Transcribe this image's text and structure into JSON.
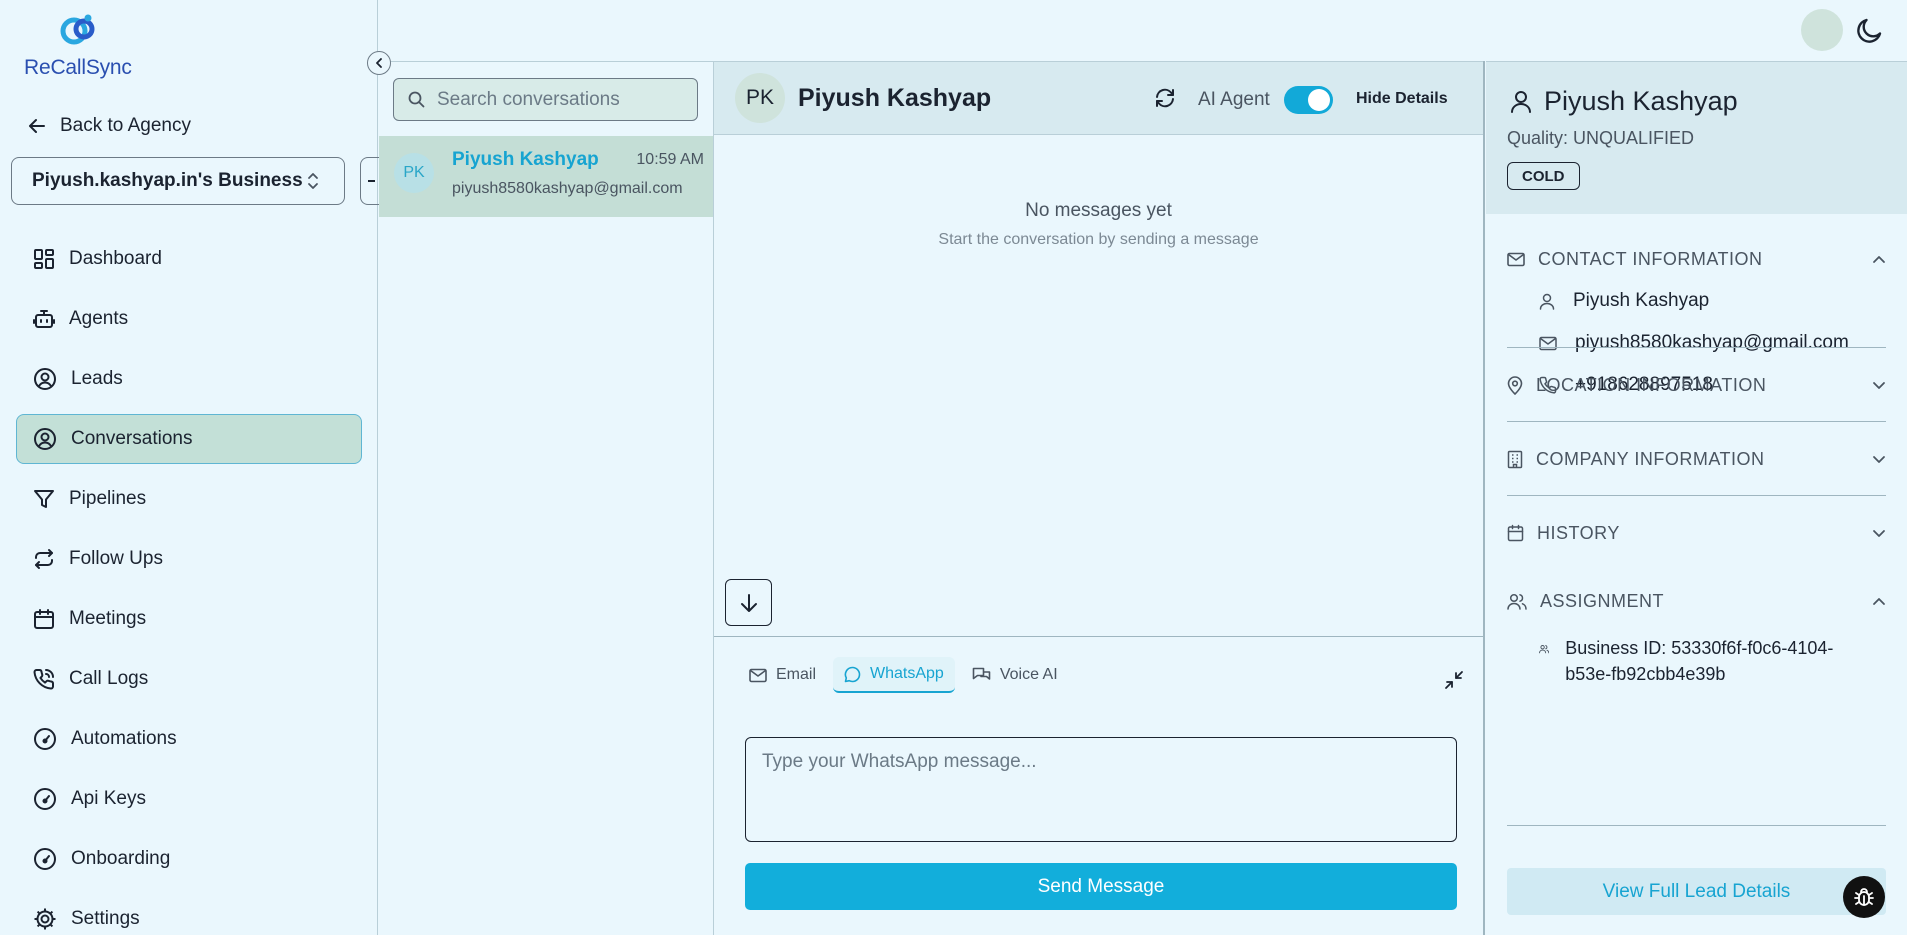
{
  "brand": {
    "name": "ReCallSync",
    "accent": "#17a4d1"
  },
  "sidebar": {
    "back_label": "Back to Agency",
    "business": "Piyush.kashyap.in's Business",
    "items": [
      {
        "label": "Dashboard",
        "icon": "dashboard-icon",
        "active": false
      },
      {
        "label": "Agents",
        "icon": "bot-icon",
        "active": false
      },
      {
        "label": "Leads",
        "icon": "user-circle-icon",
        "active": false
      },
      {
        "label": "Conversations",
        "icon": "user-circle-icon",
        "active": true
      },
      {
        "label": "Pipelines",
        "icon": "filter-icon",
        "active": false
      },
      {
        "label": "Follow Ups",
        "icon": "repeat-icon",
        "active": false
      },
      {
        "label": "Meetings",
        "icon": "calendar-icon",
        "active": false
      },
      {
        "label": "Call Logs",
        "icon": "phone-call-icon",
        "active": false
      },
      {
        "label": "Automations",
        "icon": "gauge-icon",
        "active": false
      },
      {
        "label": "Api Keys",
        "icon": "gauge-icon",
        "active": false
      },
      {
        "label": "Onboarding",
        "icon": "gauge-icon",
        "active": false
      },
      {
        "label": "Settings",
        "icon": "gear-icon",
        "active": false
      }
    ]
  },
  "conversations": {
    "search_placeholder": "Search conversations",
    "items": [
      {
        "initials": "PK",
        "name": "Piyush Kashyap",
        "time": "10:59 AM",
        "email": "piyush8580kashyap@gmail.com"
      }
    ]
  },
  "chat": {
    "initials": "PK",
    "name": "Piyush Kashyap",
    "ai_agent_label": "AI Agent",
    "ai_agent_on": true,
    "hide_details_label": "Hide Details",
    "empty_title": "No messages yet",
    "empty_subtitle": "Start the conversation by sending a message",
    "channels": [
      {
        "label": "Email",
        "icon": "mail-icon",
        "active": false
      },
      {
        "label": "WhatsApp",
        "icon": "message-circle-icon",
        "active": true
      },
      {
        "label": "Voice AI",
        "icon": "messages-icon",
        "active": false
      }
    ],
    "message_placeholder": "Type your WhatsApp message...",
    "send_label": "Send Message"
  },
  "details": {
    "name": "Piyush Kashyap",
    "quality": "Quality: UNQUALIFIED",
    "badge": "COLD",
    "contact": {
      "title": "CONTACT INFORMATION",
      "name": "Piyush Kashyap",
      "email": "piyush8580kashyap@gmail.com",
      "phone": "+918628897518"
    },
    "location_title": "LOCATION INFORMATION",
    "company_title": "COMPANY INFORMATION",
    "history_title": "HISTORY",
    "assignment": {
      "title": "ASSIGNMENT",
      "business_id": "Business ID: 53330f6f-f0c6-4104-b53e-fb92cbb4e39b"
    },
    "view_full_label": "View Full Lead Details"
  }
}
